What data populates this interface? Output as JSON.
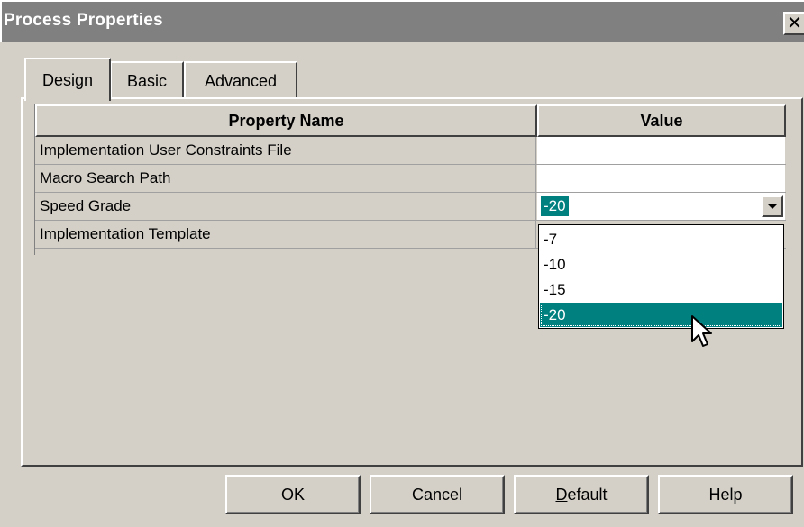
{
  "window": {
    "title": "Process Properties",
    "close_glyph": "✕"
  },
  "tabs": [
    {
      "label": "Design",
      "active": true
    },
    {
      "label": "Basic",
      "active": false
    },
    {
      "label": "Advanced",
      "active": false
    }
  ],
  "grid": {
    "columns": [
      "Property Name",
      "Value"
    ],
    "rows": [
      {
        "name": "Implementation User Constraints File",
        "value": ""
      },
      {
        "name": "Macro Search Path",
        "value": ""
      },
      {
        "name": "Speed Grade",
        "value": "-20"
      },
      {
        "name": "Implementation Template",
        "value": ""
      }
    ]
  },
  "speed_grade_dropdown": {
    "selected": "-20",
    "options": [
      "-7",
      "-10",
      "-15",
      "-20"
    ]
  },
  "buttons": {
    "ok": "OK",
    "cancel": "Cancel",
    "default_mnemonic": "D",
    "default_rest": "efault",
    "help": "Help"
  },
  "colors": {
    "selection": "#00807f",
    "titlebar": "#808080",
    "face": "#d4d0c8"
  },
  "icons": [
    "close-icon",
    "chevron-down-icon",
    "mouse-pointer-icon"
  ]
}
